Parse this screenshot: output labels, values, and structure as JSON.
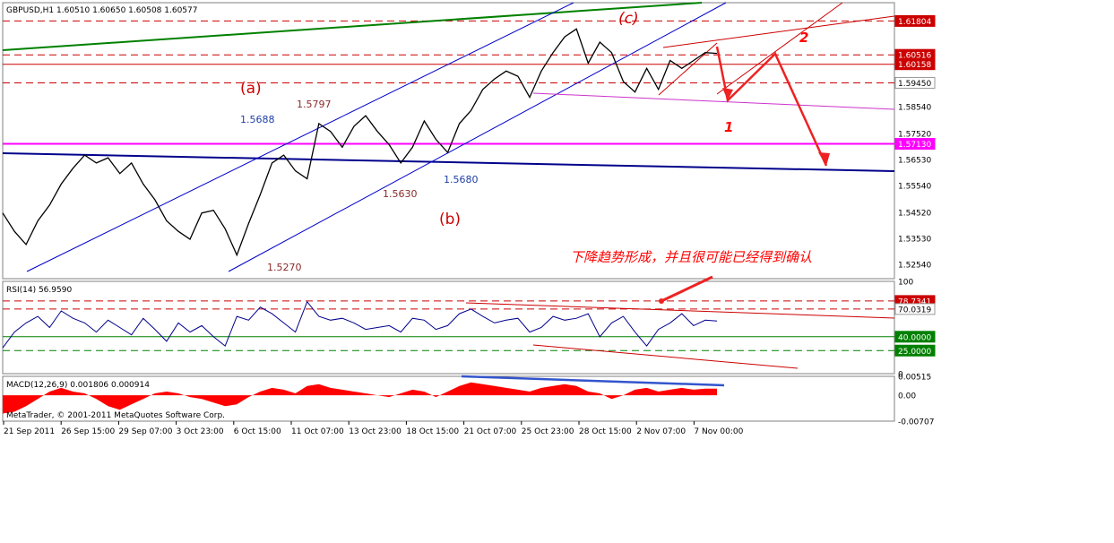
{
  "chart_data": [
    {
      "type": "line",
      "panel": "price",
      "title": "GBPUSD,H1  1.60510 1.60650 1.60508 1.60577",
      "instrument": "GBPUSD",
      "timeframe": "H1",
      "ohlc": {
        "open": 1.6051,
        "high": 1.6065,
        "low": 1.60508,
        "close": 1.60577
      },
      "ylim": [
        1.52,
        1.625
      ],
      "y_ticks": [
        "1.61804",
        "1.60516",
        "1.60158",
        "1.59450",
        "1.58540",
        "1.57520",
        "1.57130",
        "1.56530",
        "1.55540",
        "1.54520",
        "1.53530",
        "1.52540"
      ],
      "highlighted_levels": [
        {
          "label": "1.61804",
          "value": 1.61804,
          "color": "#cc0000"
        },
        {
          "label": "1.60516",
          "value": 1.60516,
          "color": "#cc0000"
        },
        {
          "label": "1.60158",
          "value": 1.60158,
          "color": "#cc0000"
        },
        {
          "label": "1.59450",
          "value": 1.5945,
          "color": "#ffffff"
        },
        {
          "label": "1.57130",
          "value": 1.5713,
          "color": "#ff00ff"
        }
      ],
      "x_ticks": [
        "21 Sep 2011",
        "26 Sep 15:00",
        "29 Sep 07:00",
        "3 Oct 23:00",
        "6 Oct 15:00",
        "11 Oct 07:00",
        "13 Oct 23:00",
        "18 Oct 15:00",
        "21 Oct 07:00",
        "25 Oct 23:00",
        "28 Oct 15:00",
        "2 Nov 07:00",
        "7 Nov 00:00"
      ],
      "series": [
        {
          "values": [
            1.545,
            1.538,
            1.533,
            1.542,
            1.548,
            1.556,
            1.562,
            1.567,
            1.564,
            1.566,
            1.56,
            1.564,
            1.556,
            1.55,
            1.542,
            1.538,
            1.535,
            1.545,
            1.546,
            1.539,
            1.529,
            1.541,
            1.552,
            1.564,
            1.567,
            1.561,
            1.558,
            1.579,
            1.576,
            1.57,
            1.578,
            1.582,
            1.576,
            1.571,
            1.564,
            1.57,
            1.58,
            1.573,
            1.568,
            1.579,
            1.584,
            1.592,
            1.596,
            1.599,
            1.597,
            1.589,
            1.599,
            1.606,
            1.612,
            1.615,
            1.602,
            1.61,
            1.606,
            1.595,
            1.591,
            1.6,
            1.592,
            1.603,
            1.6,
            1.603,
            1.606,
            1.6057
          ]
        }
      ],
      "annotations": [
        "(a)",
        "(b)",
        "(c)",
        "1",
        "2",
        "1.5688",
        "1.5797",
        "1.5630",
        "1.5680",
        "1.5270",
        "下降趋势形成，并且很可能已经得到确认"
      ]
    },
    {
      "type": "line",
      "panel": "rsi",
      "title": "RSI(14) 56.9590",
      "ylim": [
        0,
        100
      ],
      "y_ticks": [
        "100",
        "78.7341",
        "70.0319",
        "40.0000",
        "25.0000",
        "0"
      ],
      "highlighted_levels": [
        {
          "label": "78.7341",
          "value": 78.7341,
          "color": "#cc0000"
        },
        {
          "label": "70.0319",
          "value": 70.0319,
          "color": "#ffffff"
        },
        {
          "label": "40.0000",
          "value": 40.0,
          "color": "#008000"
        },
        {
          "label": "25.0000",
          "value": 25.0,
          "color": "#008000"
        }
      ],
      "series": [
        {
          "values": [
            28,
            45,
            55,
            62,
            50,
            68,
            60,
            55,
            45,
            58,
            50,
            42,
            60,
            48,
            35,
            55,
            45,
            52,
            40,
            30,
            62,
            58,
            72,
            65,
            55,
            45,
            78,
            62,
            58,
            60,
            55,
            48,
            50,
            52,
            45,
            60,
            58,
            48,
            52,
            65,
            70,
            62,
            55,
            58,
            60,
            45,
            50,
            62,
            58,
            60,
            65,
            40,
            55,
            62,
            45,
            30,
            48,
            55,
            65,
            52,
            58,
            56.959
          ]
        }
      ]
    },
    {
      "type": "area",
      "panel": "macd",
      "title": "MACD(12,26,9) 0.001806 0.000914",
      "ylim": [
        -0.00707,
        0.00515
      ],
      "y_ticks": [
        "0.00515",
        "0.00",
        "-0.00707"
      ],
      "series": [
        {
          "name": "MACD",
          "values": [
            -0.005,
            -0.0045,
            -0.003,
            -0.001,
            0.001,
            0.002,
            0.001,
            0.0005,
            -0.001,
            -0.003,
            -0.004,
            -0.0025,
            -0.001,
            0.0005,
            0.001,
            0.0005,
            -0.0005,
            -0.001,
            -0.002,
            -0.003,
            -0.0025,
            -0.0005,
            0.001,
            0.002,
            0.0015,
            0.0005,
            0.0025,
            0.003,
            0.002,
            0.0015,
            0.001,
            0.0005,
            0.0,
            -0.0005,
            0.0005,
            0.0015,
            0.001,
            -0.0005,
            0.001,
            0.0025,
            0.0035,
            0.003,
            0.0025,
            0.002,
            0.0015,
            0.001,
            0.002,
            0.0025,
            0.003,
            0.0025,
            0.001,
            0.0005,
            -0.001,
            0.0,
            0.0015,
            0.002,
            0.001,
            0.0015,
            0.002,
            0.0015,
            0.0018,
            0.0018
          ]
        }
      ]
    }
  ],
  "footer": {
    "copyright": "MetaTrader, © 2001-2011 MetaQuotes Software Corp."
  },
  "colors": {
    "price_line": "#000000",
    "red_level": "#cc0000",
    "magenta_level": "#ff00ff",
    "blue_trend": "#00008b",
    "green_trend": "#008000",
    "channel": "#0000cc",
    "rsi_line": "#00008b",
    "macd_hist": "#ff0000",
    "annotation_red": "#ff0000"
  }
}
